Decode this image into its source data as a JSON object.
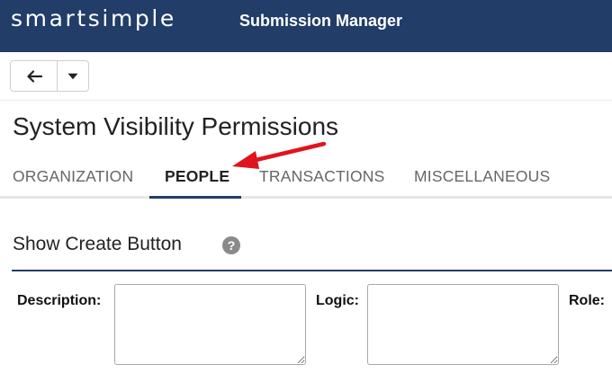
{
  "header": {
    "logo_text": "smartsimple",
    "app_title": "Submission Manager",
    "background_color": "#213d68"
  },
  "toolbar": {
    "back_icon": "arrow-left-icon",
    "dropdown_icon": "caret-down-icon"
  },
  "page": {
    "title": "System Visibility Permissions"
  },
  "tabs": [
    {
      "label": "ORGANIZATION",
      "active": false
    },
    {
      "label": "PEOPLE",
      "active": true
    },
    {
      "label": "TRANSACTIONS",
      "active": false
    },
    {
      "label": "MISCELLANEOUS",
      "active": false
    }
  ],
  "annotation": {
    "arrow_color": "#e0141e",
    "points_to": "PEOPLE"
  },
  "section": {
    "title": "Show Create Button",
    "help_glyph": "?"
  },
  "fields": {
    "description_label": "Description:",
    "description_value": "",
    "logic_label": "Logic:",
    "logic_value": "",
    "role_label": "Role:"
  }
}
